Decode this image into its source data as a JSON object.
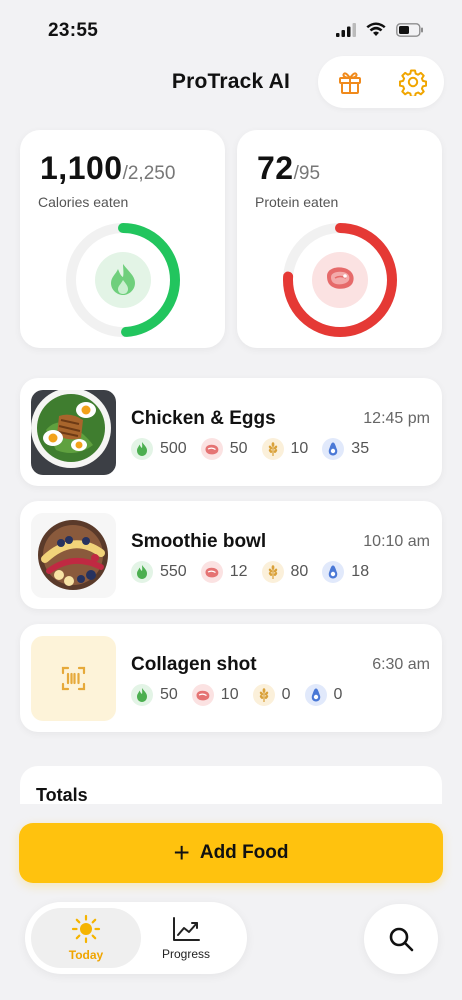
{
  "status_bar": {
    "time": "23:55"
  },
  "header": {
    "title": "ProTrack AI"
  },
  "stats": {
    "calories": {
      "eaten": "1,100",
      "goal": "/2,250",
      "label": "Calories eaten",
      "progress": 0.49,
      "color": "#22c55e"
    },
    "protein": {
      "eaten": "72",
      "goal": "/95",
      "label": "Protein eaten",
      "progress": 0.76,
      "color": "#e53935"
    }
  },
  "meals": [
    {
      "name": "Chicken & Eggs",
      "time": "12:45 pm",
      "calories": "500",
      "protein": "50",
      "carbs": "10",
      "fat": "35"
    },
    {
      "name": "Smoothie bowl",
      "time": "10:10 am",
      "calories": "550",
      "protein": "12",
      "carbs": "80",
      "fat": "18"
    },
    {
      "name": "Collagen shot",
      "time": "6:30 am",
      "calories": "50",
      "protein": "10",
      "carbs": "0",
      "fat": "0"
    }
  ],
  "totals": {
    "title": "Totals"
  },
  "actions": {
    "add_food_plus": "+",
    "add_food_label": "Add Food"
  },
  "nav": {
    "today": "Today",
    "progress": "Progress"
  },
  "colors": {
    "accent": "#ffc20e",
    "calories": "#22c55e",
    "protein": "#e53935",
    "carbs": "#e0a030",
    "fat": "#3b6fd8"
  }
}
